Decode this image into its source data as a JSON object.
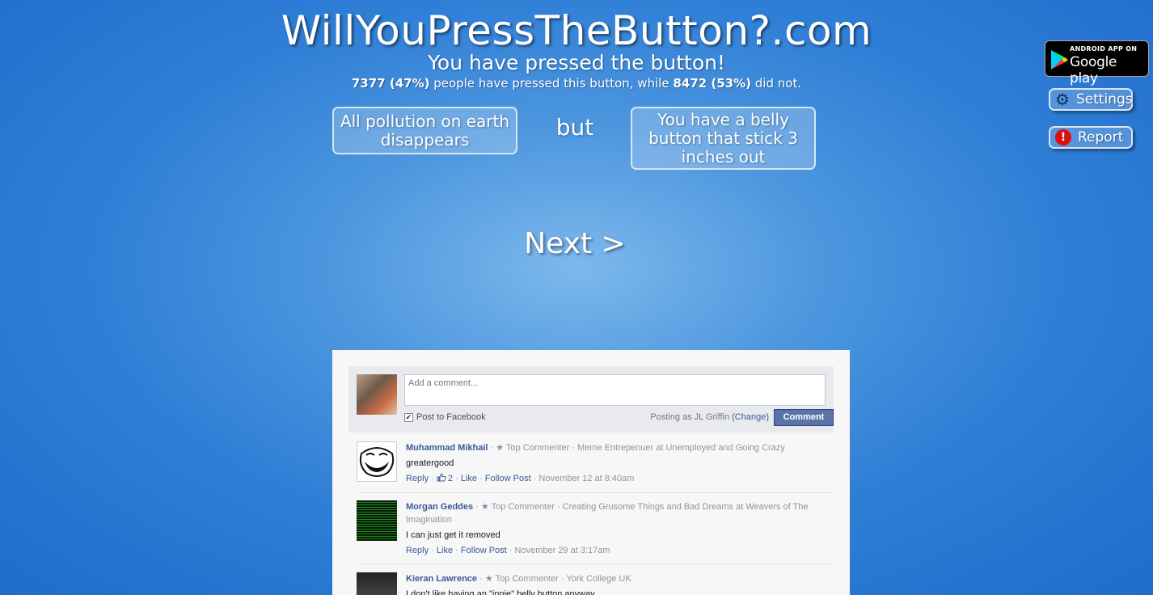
{
  "header": {
    "title": "WillYouPressTheButton?.com",
    "subtitle": "You have pressed the button!",
    "stats": {
      "pressed_count": "7377 (47%)",
      "middle_text": " people have pressed this button, while ",
      "not_pressed_count": "8472 (53%)",
      "end_text": " did not."
    }
  },
  "dilemma": {
    "benefit": "All pollution on earth disappears",
    "connector": "but",
    "consequence": "You have a belly button that stick 3 inches out"
  },
  "navigation": {
    "next_label": "Next >"
  },
  "sidebar": {
    "play_badge_small": "ANDROID APP ON",
    "play_badge_big": "Google play",
    "settings_label": "Settings",
    "report_label": "Report"
  },
  "comments_widget": {
    "compose": {
      "placeholder": "Add a comment...",
      "post_to_facebook_label": "Post to Facebook",
      "posting_as_text": "Posting as JL Griffin ",
      "change_link": "(Change)",
      "comment_button": "Comment"
    },
    "comments": [
      {
        "author": "Muhammad Mikhail",
        "badge": "Top Commenter",
        "bio": "Meme Entrepenuer at Unemployed and Going Crazy",
        "text": "greatergood",
        "reply": "Reply",
        "likes": "2",
        "like": "Like",
        "follow": "Follow Post",
        "time": "November 12 at 8:40am"
      },
      {
        "author": "Morgan Geddes",
        "badge": "Top Commenter",
        "bio": "Creating Grusome Things and Bad Dreams at Weavers of The Imagination",
        "text": "I can just get it removed",
        "reply": "Reply",
        "like": "Like",
        "follow": "Follow Post",
        "time": "November 29 at 3:17am"
      },
      {
        "author": "Kieran Lawrence",
        "badge": "Top Commenter",
        "bio": "York College UK",
        "text": "I don't like having an \"innie\" belly button anyway"
      }
    ]
  },
  "colors": {
    "background_center": "#7db8ec",
    "background_edge": "#1f6ccc",
    "facebook_link": "#3b5998",
    "report_red": "#e00d0d"
  }
}
